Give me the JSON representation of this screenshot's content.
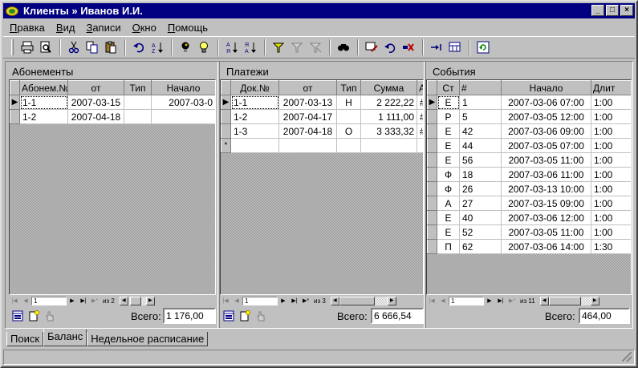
{
  "window": {
    "title": "Клиенты » Иванов И.И.",
    "buttons": [
      "_",
      "□",
      "×"
    ]
  },
  "menu": [
    {
      "label": "Правка",
      "key": "П",
      "rest": "равка"
    },
    {
      "label": "Вид",
      "key": "В",
      "rest": "ид"
    },
    {
      "label": "Записи",
      "key": "З",
      "rest": "аписи"
    },
    {
      "label": "Окно",
      "key": "О",
      "rest": "кно"
    },
    {
      "label": "Помощь",
      "key": "П",
      "rest": "омощь"
    }
  ],
  "panels": {
    "subscriptions": {
      "title": "Абонементы",
      "columns": [
        "Абонем.№",
        "от",
        "Тип",
        "Начало"
      ],
      "rows": [
        [
          "1-1",
          "2007-03-15",
          "",
          "2007-03-0"
        ],
        [
          "1-2",
          "2007-04-18",
          "",
          ""
        ]
      ],
      "nav_page": "1",
      "nav_of": "из 2",
      "total_label": "Всего:",
      "total_value": "1 176,00"
    },
    "payments": {
      "title": "Платежи",
      "columns": [
        "Док.№",
        "от",
        "Тип",
        "Сумма",
        "А"
      ],
      "rows": [
        [
          "1-1",
          "2007-03-13",
          "Н",
          "2 222,22",
          "#"
        ],
        [
          "1-2",
          "2007-04-17",
          "",
          "1 111,00",
          "#"
        ],
        [
          "1-3",
          "2007-04-18",
          "О",
          "3 333,32",
          "#"
        ]
      ],
      "new_row_marker": "*",
      "nav_page": "1",
      "nav_of": "из 3",
      "total_label": "Всего:",
      "total_value": "6 666,54"
    },
    "events": {
      "title": "События",
      "columns": [
        "Ст",
        "#",
        "Начало",
        "Длит"
      ],
      "rows": [
        [
          "Е",
          "1",
          "2007-03-06 07:00",
          "1:00"
        ],
        [
          "Р",
          "5",
          "2007-03-05 12:00",
          "1:00"
        ],
        [
          "Е",
          "42",
          "2007-03-06 09:00",
          "1:00"
        ],
        [
          "Е",
          "44",
          "2007-03-05 07:00",
          "1:00"
        ],
        [
          "Е",
          "56",
          "2007-03-05 11:00",
          "1:00"
        ],
        [
          "Ф",
          "18",
          "2007-03-06 11:00",
          "1:00"
        ],
        [
          "Ф",
          "26",
          "2007-03-13 10:00",
          "1:00"
        ],
        [
          "А",
          "27",
          "2007-03-15 09:00",
          "1:00"
        ],
        [
          "Е",
          "40",
          "2007-03-06 12:00",
          "1:00"
        ],
        [
          "Е",
          "52",
          "2007-03-05 11:00",
          "1:00"
        ],
        [
          "П",
          "62",
          "2007-03-06 14:00",
          "1:30"
        ]
      ],
      "nav_page": "1",
      "nav_of": "из 11",
      "total_label": "Всего:",
      "total_value": "464,00"
    }
  },
  "tabs": [
    {
      "label": "Поиск",
      "active": false
    },
    {
      "label": "Баланс",
      "active": true
    },
    {
      "label": "Недельное расписание",
      "active": false
    }
  ],
  "icons": {
    "toolbar": [
      "print-icon",
      "print-preview-icon",
      "cut-icon",
      "copy-icon",
      "paste-icon",
      "undo-icon",
      "sort-custom-icon",
      "lightbulb-off-icon",
      "lightbulb-icon",
      "sort-asc-icon",
      "sort-desc-icon",
      "filter-icon",
      "filter-apply-icon",
      "filter-remove-icon",
      "find-icon",
      "record-edit-icon",
      "record-undo-icon",
      "record-delete-icon",
      "goto-icon",
      "calculator-icon",
      "refresh-icon"
    ]
  }
}
